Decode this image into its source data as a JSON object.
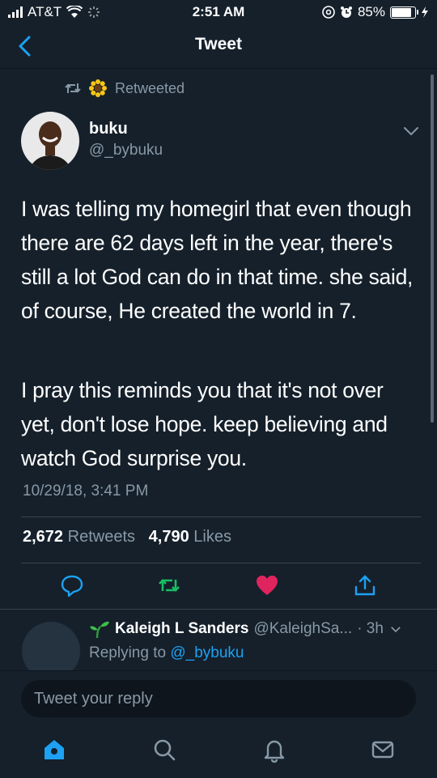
{
  "status_bar": {
    "carrier": "AT&T",
    "time": "2:51 AM",
    "battery": "85%",
    "battery_level": 0.85,
    "icons": [
      "signal-icon",
      "wifi-icon",
      "activity-icon",
      "at-icon",
      "alarm-icon",
      "battery-icon",
      "charging-icon"
    ]
  },
  "nav": {
    "title": "Tweet"
  },
  "retweet": {
    "label": "Retweeted"
  },
  "tweet": {
    "author_name": "buku",
    "author_handle": "@_bybuku",
    "paragraphs": [
      "I was telling my homegirl that even though there are 62 days left in the year, there's still a lot God can do in that time. she said, of course, He created the world in 7.",
      "I pray this reminds you that it's not over yet, don't lose hope. keep believing and watch God surprise you."
    ],
    "timestamp": "10/29/18, 3:41 PM",
    "retweets_count": "2,672",
    "retweets_label": "Retweets",
    "likes_count": "4,790",
    "likes_label": "Likes"
  },
  "reply": {
    "name": "Kaleigh L Sanders",
    "handle": "@KaleighSa...",
    "time": "· 3h",
    "replying_label": "Replying to",
    "replying_handle": "@_bybuku"
  },
  "composer": {
    "placeholder": "Tweet your reply"
  },
  "colors": {
    "background": "#15202b",
    "accent": "#1da1f2",
    "like": "#e0245e",
    "retweet": "#17bf63",
    "muted": "#8899a6"
  }
}
